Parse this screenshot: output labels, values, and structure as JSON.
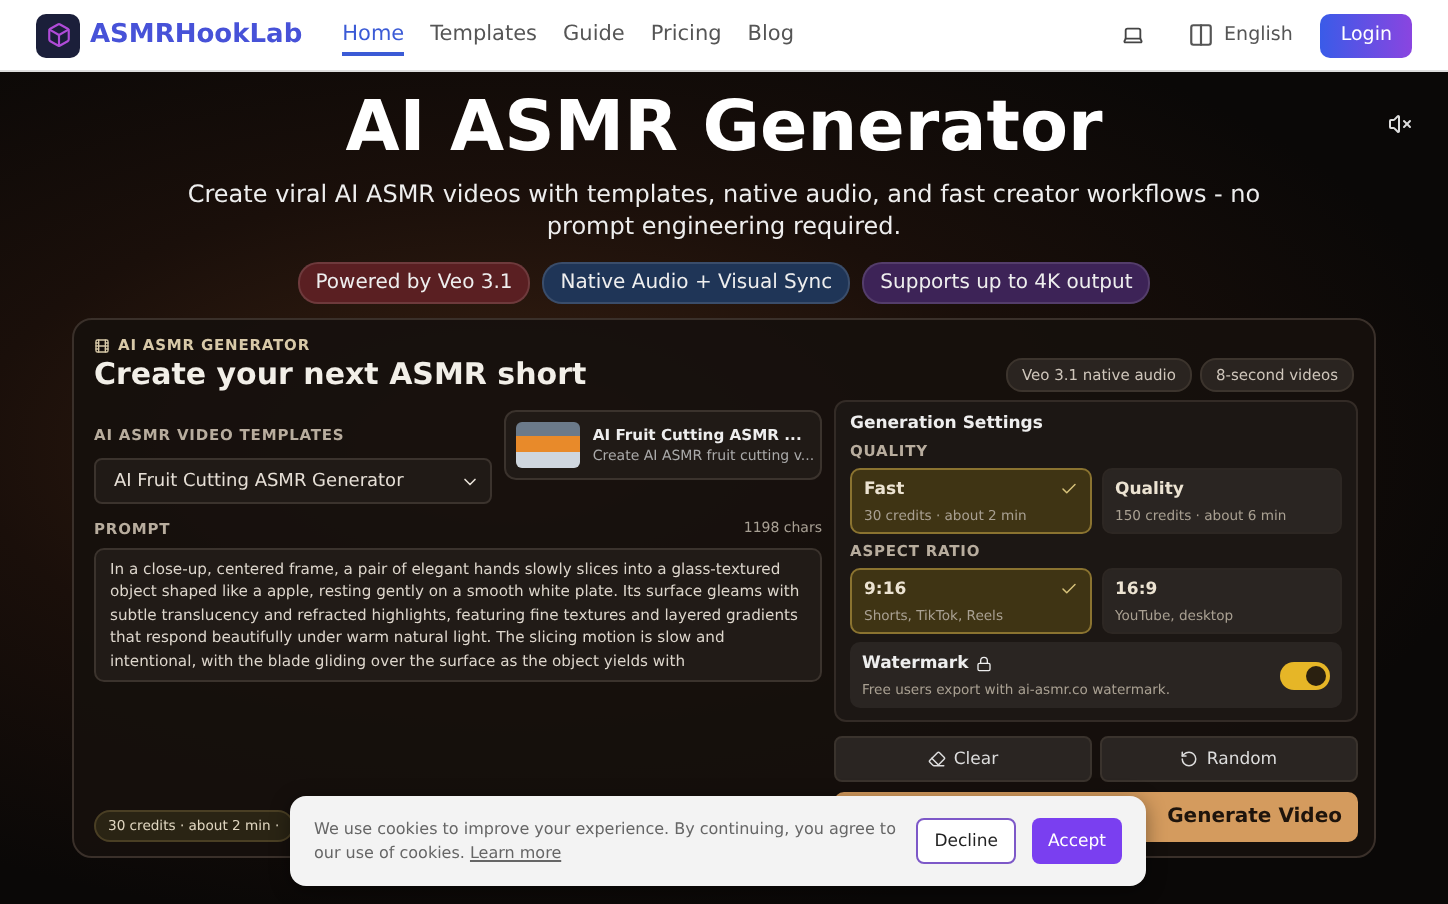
{
  "header": {
    "brand": "ASMRHookLab",
    "nav": [
      {
        "label": "Home",
        "selected": true
      },
      {
        "label": "Templates",
        "selected": false
      },
      {
        "label": "Guide",
        "selected": false
      },
      {
        "label": "Pricing",
        "selected": false
      },
      {
        "label": "Blog",
        "selected": false
      }
    ],
    "language": "English",
    "login": "Login"
  },
  "hero": {
    "title": "AI ASMR Generator",
    "subtitle": "Create viral AI ASMR videos with templates, native audio, and fast creator workflows - no prompt engineering required.",
    "badges": [
      {
        "label": "Powered by Veo 3.1",
        "color": "#5a1f22"
      },
      {
        "label": "Native Audio + Visual Sync",
        "color": "#1f3557"
      },
      {
        "label": "Supports up to 4K output",
        "color": "#3d2357"
      }
    ]
  },
  "generator": {
    "eyebrow": "AI ASMR GENERATOR",
    "heading": "Create your next ASMR short",
    "chips": [
      "Veo 3.1 native audio",
      "8-second videos"
    ],
    "templates_label": "AI ASMR VIDEO TEMPLATES",
    "template_select": "AI Fruit Cutting ASMR Generator",
    "template_card": {
      "title": "AI Fruit Cutting ASMR ...",
      "description": "Create AI ASMR fruit cutting v..."
    },
    "prompt_label": "PROMPT",
    "prompt_count": "1198 chars",
    "prompt": "In a close-up, centered frame, a pair of elegant hands slowly slices into a glass-textured object shaped like a apple, resting gently on a smooth white plate. Its surface gleams with subtle translucency and refracted highlights, featuring fine textures and layered gradients that respond beautifully under warm natural light. The slicing motion is slow and intentional, with the blade gliding over the surface as the object yields with",
    "summary": "30 credits · about 2 min ·",
    "settings": {
      "title": "Generation Settings",
      "quality_label": "QUALITY",
      "quality": [
        {
          "name": "Fast",
          "detail": "30 credits · about 2 min",
          "selected": true
        },
        {
          "name": "Quality",
          "detail": "150 credits · about 6 min",
          "selected": false
        }
      ],
      "aspect_label": "ASPECT RATIO",
      "aspect": [
        {
          "name": "9:16",
          "detail": "Shorts, TikTok, Reels",
          "selected": true
        },
        {
          "name": "16:9",
          "detail": "YouTube, desktop",
          "selected": false
        }
      ],
      "watermark": {
        "title": "Watermark",
        "detail": "Free users export with ai-asmr.co watermark.",
        "on": true
      }
    },
    "clear": "Clear",
    "random": "Random",
    "generate": "Generate Video"
  },
  "cookie": {
    "text": "We use cookies to improve your experience. By continuing, you agree to our use of cookies.",
    "link": "Learn more",
    "decline": "Decline",
    "accept": "Accept"
  }
}
